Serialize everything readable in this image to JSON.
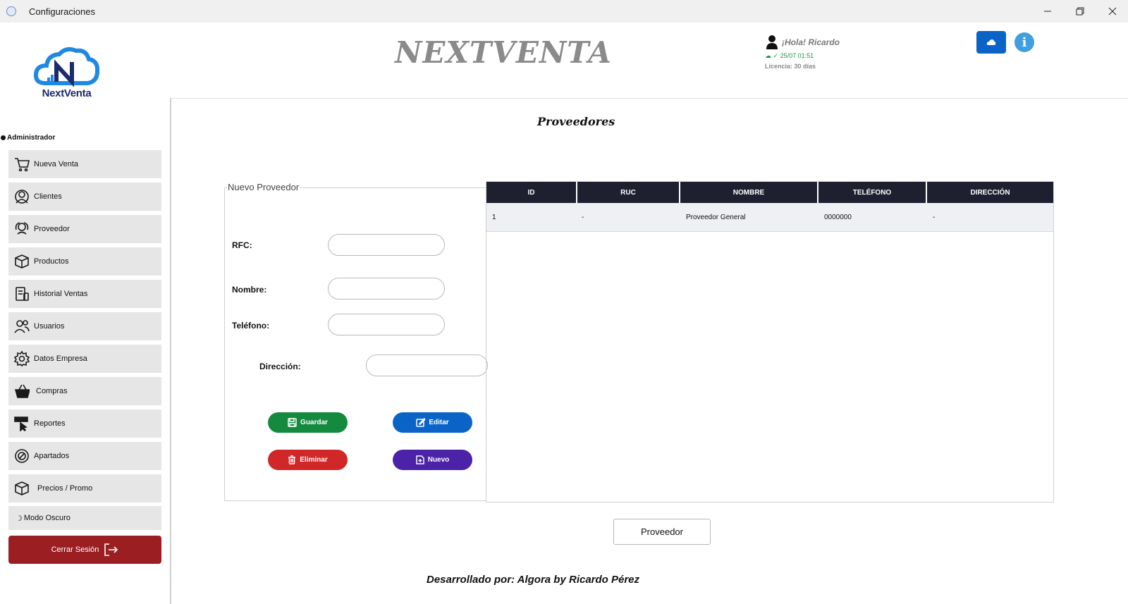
{
  "window": {
    "title": "Configuraciones"
  },
  "colors": {
    "sidebar_item": "#e6e6e6",
    "logout": "#9b1f22",
    "table_header": "#1e2030",
    "guardar": "#138a3e",
    "editar": "#0a64c8",
    "eliminar": "#d02828",
    "nuevo": "#4b22a8",
    "accent_blue": "#0a64c8"
  },
  "sidebar": {
    "logo_text": "NextVenta",
    "role": "Administrador",
    "items": [
      {
        "label": "Nueva Venta",
        "icon": "cart-icon"
      },
      {
        "label": "Clientes",
        "icon": "clients-icon"
      },
      {
        "label": "Proveedor",
        "icon": "supplier-icon"
      },
      {
        "label": "Productos",
        "icon": "box-icon"
      },
      {
        "label": "Historial Ventas",
        "icon": "history-icon"
      },
      {
        "label": "Usuarios",
        "icon": "users-icon"
      },
      {
        "label": "Datos Empresa",
        "icon": "gear-icon"
      },
      {
        "label": "Compras",
        "icon": "basket-icon"
      },
      {
        "label": "Reportes",
        "icon": "report-icon"
      },
      {
        "label": "Apartados",
        "icon": "layaway-icon"
      },
      {
        "label": "Precios / Promo",
        "icon": "price-box-icon"
      }
    ],
    "dark_mode": "Modo Oscuro",
    "logout": "Cerrar Sesión"
  },
  "header": {
    "brand": "NEXTVENTA",
    "greeting": "¡Hola! Ricardo",
    "date": "25/07 01:51",
    "license": "Licencia: 30 días"
  },
  "page": {
    "title": "Proveedores"
  },
  "form": {
    "legend": "Nuevo Proveedor",
    "rfc_label": "RFC:",
    "rfc_value": "",
    "nombre_label": "Nombre:",
    "nombre_value": "",
    "telefono_label": "Teléfono:",
    "telefono_value": "",
    "direccion_label": "Dirección:",
    "direccion_value": "",
    "buttons": {
      "guardar": "Guardar",
      "editar": "Editar",
      "eliminar": "Eliminar",
      "nuevo": "Nuevo"
    }
  },
  "table": {
    "columns": [
      "ID",
      "RUC",
      "NOMBRE",
      "TELÉFONO",
      "DIRECCIÓN"
    ],
    "rows": [
      [
        "1",
        "-",
        "Proveedor General",
        "0000000",
        "-"
      ]
    ]
  },
  "bottom_button": "Proveedor",
  "footer": "Desarrollado por: Algora by Ricardo Pérez"
}
